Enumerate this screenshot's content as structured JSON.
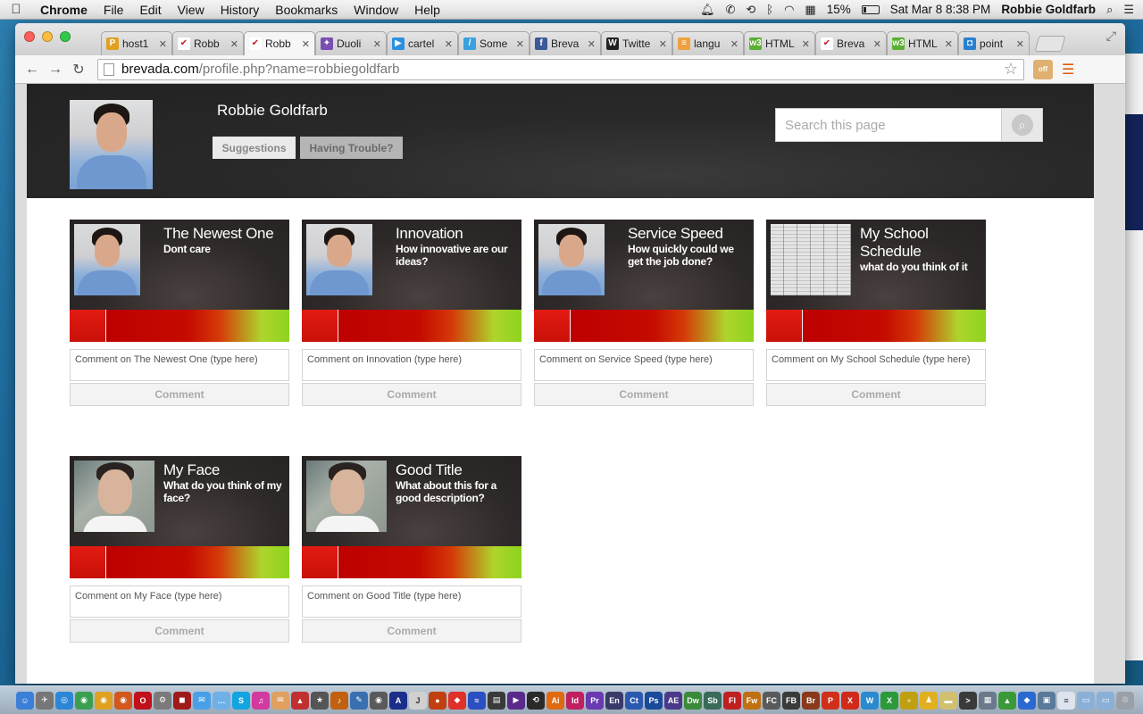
{
  "menubar": {
    "app_name": "Chrome",
    "items": [
      "File",
      "Edit",
      "View",
      "History",
      "Bookmarks",
      "Window",
      "Help"
    ],
    "battery": "15%",
    "datetime": "Sat Mar 8  8:38 PM",
    "user": "Robbie Goldfarb"
  },
  "tabs": [
    {
      "label": "host1",
      "color": "#e0a020",
      "glyph": "P",
      "active": false
    },
    {
      "label": "Robb",
      "color": "#ffffff",
      "glyph": "✔",
      "active": false
    },
    {
      "label": "Robb",
      "color": "#ffffff",
      "glyph": "✔",
      "active": true
    },
    {
      "label": "Duoli",
      "color": "#7a4fb0",
      "glyph": "✦",
      "active": false
    },
    {
      "label": "cartel",
      "color": "#2a90e0",
      "glyph": "▶",
      "active": false
    },
    {
      "label": "Some",
      "color": "#3aa0e0",
      "glyph": "/",
      "active": false
    },
    {
      "label": "Breva",
      "color": "#3b5998",
      "glyph": "f",
      "active": false
    },
    {
      "label": "Twitte",
      "color": "#222222",
      "glyph": "W",
      "active": false
    },
    {
      "label": "langu",
      "color": "#f0a040",
      "glyph": "≡",
      "active": false
    },
    {
      "label": "HTML",
      "color": "#5ab030",
      "glyph": "w3",
      "active": false
    },
    {
      "label": "Breva",
      "color": "#ffffff",
      "glyph": "✔",
      "active": false
    },
    {
      "label": "HTML",
      "color": "#5ab030",
      "glyph": "w3",
      "active": false
    },
    {
      "label": "point",
      "color": "#2a80d0",
      "glyph": "◘",
      "active": false
    }
  ],
  "address": {
    "domain": "brevada.com",
    "path": "/profile.php?name=robbiegoldfarb"
  },
  "profile": {
    "name": "Robbie Goldfarb",
    "suggestions_label": "Suggestions",
    "trouble_label": "Having Trouble?",
    "search_placeholder": "Search this page"
  },
  "cards": [
    {
      "title": "The Newest One",
      "description": "Dont care",
      "comment_placeholder": "Comment on The Newest One  (type here)",
      "button": "Comment",
      "thumb": "portrait"
    },
    {
      "title": "Innovation",
      "description": "How innovative are our ideas?",
      "comment_placeholder": "Comment on Innovation (type here)",
      "button": "Comment",
      "thumb": "portrait"
    },
    {
      "title": "Service Speed",
      "description": "How quickly could we get the job done?",
      "comment_placeholder": "Comment on Service Speed (type here)",
      "button": "Comment",
      "thumb": "portrait"
    },
    {
      "title": "My School Schedule",
      "description": "what do you think of it",
      "comment_placeholder": "Comment on My School Schedule (type here)",
      "button": "Comment",
      "thumb": "schedule"
    },
    {
      "title": "My Face",
      "description": "What do you think of my face?",
      "comment_placeholder": "Comment on My Face (type here)",
      "button": "Comment",
      "thumb": "webcam"
    },
    {
      "title": "Good Title",
      "description": "What about this for a good description?",
      "comment_placeholder": "Comment on Good Title (type here)",
      "button": "Comment",
      "thumb": "webcam"
    }
  ],
  "dock_apps": [
    {
      "name": "finder",
      "color": "#3b7fd8",
      "glyph": "☺"
    },
    {
      "name": "launchpad",
      "color": "#777777",
      "glyph": "✈"
    },
    {
      "name": "safari",
      "color": "#2c86d6",
      "glyph": "◎"
    },
    {
      "name": "chrome",
      "color": "#3aa050",
      "glyph": "◉"
    },
    {
      "name": "chrome-canary",
      "color": "#e0a020",
      "glyph": "◉"
    },
    {
      "name": "firefox",
      "color": "#d2581e",
      "glyph": "◉"
    },
    {
      "name": "opera",
      "color": "#c0101a",
      "glyph": "O"
    },
    {
      "name": "settings",
      "color": "#7a7a7a",
      "glyph": "⚙"
    },
    {
      "name": "photobooth",
      "color": "#a01a1a",
      "glyph": "◼"
    },
    {
      "name": "messages",
      "color": "#4aa0e8",
      "glyph": "✉"
    },
    {
      "name": "ichat",
      "color": "#6fb0e8",
      "glyph": "…"
    },
    {
      "name": "skype",
      "color": "#12a5e0",
      "glyph": "S"
    },
    {
      "name": "itunes",
      "color": "#d23aa0",
      "glyph": "♫"
    },
    {
      "name": "mail",
      "color": "#e0a060",
      "glyph": "✉"
    },
    {
      "name": "photos",
      "color": "#c03030",
      "glyph": "▲"
    },
    {
      "name": "gamecenter",
      "color": "#555555",
      "glyph": "★"
    },
    {
      "name": "garageband",
      "color": "#c06010",
      "glyph": "♪"
    },
    {
      "name": "xcode",
      "color": "#3a6fb0",
      "glyph": "✎"
    },
    {
      "name": "instruments",
      "color": "#5a5a5a",
      "glyph": "◉"
    },
    {
      "name": "fonts",
      "color": "#1a2e8a",
      "glyph": "A"
    },
    {
      "name": "j",
      "color": "#d0d0d0",
      "glyph": "J"
    },
    {
      "name": "burn",
      "color": "#c04010",
      "glyph": "●"
    },
    {
      "name": "scanner",
      "color": "#e0302a",
      "glyph": "◆"
    },
    {
      "name": "wacom",
      "color": "#2a4fc0",
      "glyph": "≈"
    },
    {
      "name": "imovie",
      "color": "#3a3a3a",
      "glyph": "▤"
    },
    {
      "name": "dvd",
      "color": "#5a2a8a",
      "glyph": "▶"
    },
    {
      "name": "timemachine",
      "color": "#2a2a2a",
      "glyph": "⟲"
    },
    {
      "name": "illustrator",
      "color": "#e06a10",
      "glyph": "Ai"
    },
    {
      "name": "indesign",
      "color": "#c02060",
      "glyph": "Id"
    },
    {
      "name": "premiere",
      "color": "#6a3ab0",
      "glyph": "Pr"
    },
    {
      "name": "encore",
      "color": "#3a3a6a",
      "glyph": "En"
    },
    {
      "name": "captivate",
      "color": "#2a5ab0",
      "glyph": "Ct"
    },
    {
      "name": "photoshop",
      "color": "#1a4a9a",
      "glyph": "Ps"
    },
    {
      "name": "aftereffects",
      "color": "#4a3a8a",
      "glyph": "AE"
    },
    {
      "name": "dreamweaver",
      "color": "#3a8a3a",
      "glyph": "Dw"
    },
    {
      "name": "soundbooth",
      "color": "#3a6a5a",
      "glyph": "Sb"
    },
    {
      "name": "flash",
      "color": "#c02020",
      "glyph": "Fl"
    },
    {
      "name": "fireworks",
      "color": "#c07010",
      "glyph": "Fw"
    },
    {
      "name": "flashcatalyst",
      "color": "#5a5a5a",
      "glyph": "FC"
    },
    {
      "name": "flashbuilder",
      "color": "#3a3a3a",
      "glyph": "FB"
    },
    {
      "name": "bridge",
      "color": "#8a3a1a",
      "glyph": "Br"
    },
    {
      "name": "powerpoint",
      "color": "#d0301a",
      "glyph": "P"
    },
    {
      "name": "excel",
      "color": "#d02a1a",
      "glyph": "X"
    },
    {
      "name": "word",
      "color": "#2a8ad0",
      "glyph": "W"
    },
    {
      "name": "excel2",
      "color": "#2a9a3a",
      "glyph": "X"
    },
    {
      "name": "symbols",
      "color": "#c0a010",
      "glyph": "♆"
    },
    {
      "name": "character",
      "color": "#e0b020",
      "glyph": "♟"
    },
    {
      "name": "notes",
      "color": "#d0c070",
      "glyph": "▬"
    },
    {
      "name": "terminal",
      "color": "#3a3a3a",
      "glyph": ">"
    },
    {
      "name": "network",
      "color": "#6a7a8a",
      "glyph": "▦"
    },
    {
      "name": "drive",
      "color": "#3a9a3a",
      "glyph": "▲"
    },
    {
      "name": "dropbox",
      "color": "#2a6ad0",
      "glyph": "◆"
    },
    {
      "name": "preview",
      "color": "#5a7a9a",
      "glyph": "▣"
    },
    {
      "name": "document",
      "color": "#dde4ee",
      "glyph": "≡"
    },
    {
      "name": "folder",
      "color": "#8ab0d8",
      "glyph": "▭"
    },
    {
      "name": "folder2",
      "color": "#8ab0d8",
      "glyph": "▭"
    },
    {
      "name": "trash",
      "color": "#9aa0a8",
      "glyph": "♲"
    }
  ]
}
